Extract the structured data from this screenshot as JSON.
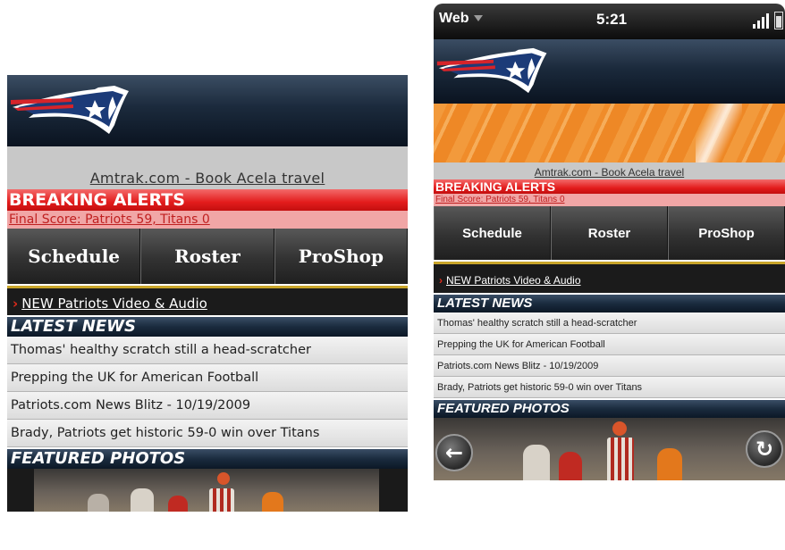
{
  "statusbar": {
    "app": "Web",
    "time": "5:21"
  },
  "ad": {
    "link": "Amtrak.com - Book Acela travel"
  },
  "alerts": {
    "title": "BREAKING ALERTS",
    "item": "Final Score: Patriots 59, Titans 0"
  },
  "nav": {
    "items": [
      "Schedule",
      "Roster",
      "ProShop"
    ]
  },
  "video": {
    "link": "NEW Patriots Video & Audio"
  },
  "latest_news": {
    "title": "LATEST NEWS",
    "items": [
      "Thomas' healthy scratch still a head-scratcher",
      "Prepping the UK for American Football",
      "Patriots.com News Blitz - 10/19/2009",
      "Brady, Patriots get historic 59-0 win over Titans"
    ]
  },
  "featured_photos": {
    "title": "FEATURED PHOTOS"
  },
  "icons": {
    "back": "back-arrow-icon",
    "reload": "reload-icon",
    "logo": "patriots-logo-icon",
    "chevron": "chevron-right-icon"
  },
  "colors": {
    "alert_red": "#e31c1c",
    "alert_pink": "#f1a6a6",
    "header_navy": "#1b2a3c",
    "video_gold": "#c9a52a"
  }
}
